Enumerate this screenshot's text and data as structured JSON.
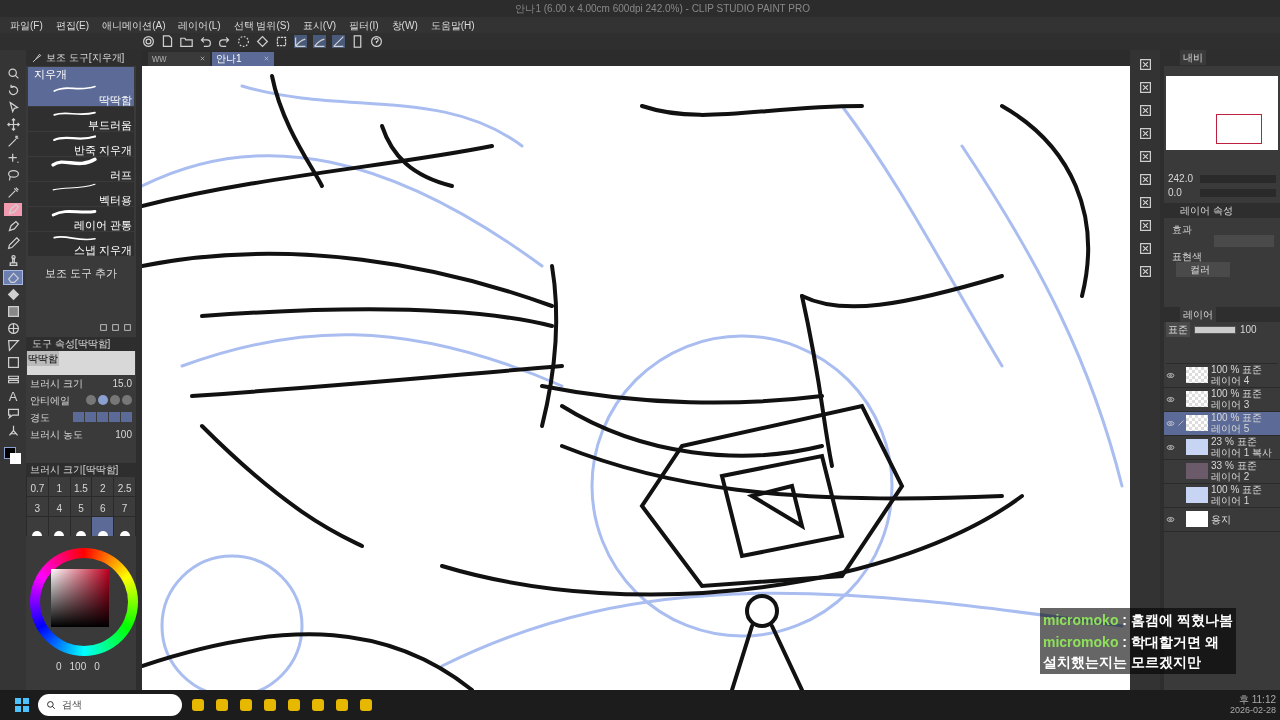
{
  "window": {
    "title": "안나1 (6.00 x 4.00cm 600dpi 242.0%) - CLIP STUDIO PAINT PRO"
  },
  "menu": [
    "파일(F)",
    "편집(E)",
    "애니메이션(A)",
    "레이어(L)",
    "선택 범위(S)",
    "표시(V)",
    "필터(I)",
    "창(W)",
    "도움말(H)"
  ],
  "document_tabs": [
    {
      "label": "ww",
      "selected": false
    },
    {
      "label": "안나1",
      "selected": true
    }
  ],
  "tools": [
    {
      "kind": "zoom",
      "selected": false,
      "marked": false
    },
    {
      "kind": "rotate",
      "selected": false,
      "marked": false
    },
    {
      "kind": "select",
      "selected": false,
      "marked": false
    },
    {
      "kind": "move",
      "selected": false,
      "marked": false
    },
    {
      "kind": "wand",
      "selected": false,
      "marked": false
    },
    {
      "kind": "sparkle",
      "selected": false,
      "marked": false
    },
    {
      "kind": "lasso",
      "selected": false,
      "marked": false
    },
    {
      "kind": "dropper",
      "selected": false,
      "marked": false
    },
    {
      "kind": "pen",
      "selected": false,
      "marked": true
    },
    {
      "kind": "pen",
      "selected": false,
      "marked": false
    },
    {
      "kind": "pencil",
      "selected": false,
      "marked": false
    },
    {
      "kind": "stamp",
      "selected": false,
      "marked": false
    },
    {
      "kind": "eraser",
      "selected": true,
      "marked": false
    },
    {
      "kind": "bucket",
      "selected": false,
      "marked": false
    },
    {
      "kind": "gradient",
      "selected": false,
      "marked": false
    },
    {
      "kind": "grid",
      "selected": false,
      "marked": false
    },
    {
      "kind": "triangle",
      "selected": false,
      "marked": false
    },
    {
      "kind": "square",
      "selected": false,
      "marked": false
    },
    {
      "kind": "stack",
      "selected": false,
      "marked": false
    },
    {
      "kind": "text",
      "glyph": "A",
      "selected": false,
      "marked": false
    },
    {
      "kind": "balloon",
      "selected": false,
      "marked": false
    },
    {
      "kind": "line",
      "selected": false,
      "marked": false
    }
  ],
  "subtool_panel": {
    "title": "보조 도구[지우개]",
    "group": "지우개",
    "items": [
      {
        "label": "딱딱함",
        "selected": true
      },
      {
        "label": "부드러움",
        "selected": false
      },
      {
        "label": "반죽 지우개",
        "selected": false
      },
      {
        "label": "러프",
        "selected": false
      },
      {
        "label": "벡터용",
        "selected": false
      },
      {
        "label": "레이어 관통",
        "selected": false
      },
      {
        "label": "스냅 지우개",
        "selected": false
      }
    ],
    "add_button": "보조 도구 추가"
  },
  "tool_property": {
    "title": "도구 속성[딱딱함]",
    "preview_label": "딱딱함",
    "brush_size_label": "브러시 크기",
    "brush_size": "15.0",
    "antialias_label": "안티에일",
    "antialias_options": [
      {
        "selected": false
      },
      {
        "selected": true
      },
      {
        "selected": false
      },
      {
        "selected": false
      }
    ],
    "hardness_label": "경도",
    "density_label": "브러시 농도",
    "density": "100"
  },
  "brush_size_panel": {
    "title": "브러시 크기[딱딱함]",
    "sizes": [
      {
        "label": "0.7",
        "selected": false
      },
      {
        "label": "1",
        "selected": false
      },
      {
        "label": "1.5",
        "selected": false
      },
      {
        "label": "2",
        "selected": false
      },
      {
        "label": "2.5",
        "selected": false
      },
      {
        "label": "3",
        "selected": false
      },
      {
        "label": "4",
        "selected": false
      },
      {
        "label": "5",
        "selected": false
      },
      {
        "label": "6",
        "selected": false
      },
      {
        "label": "7",
        "selected": false
      },
      {
        "selected": false
      },
      {
        "selected": false
      },
      {
        "selected": false
      },
      {
        "selected": true
      },
      {
        "selected": false
      }
    ]
  },
  "color_panel": {
    "readouts": [
      "0",
      "100",
      "0"
    ]
  },
  "navigator": {
    "title": "내비",
    "zoom": "242.0",
    "rotation": "0.0"
  },
  "layer_property": {
    "title": "레이어 속성",
    "effect_label": "효과",
    "expression_label": "표현색",
    "expression_value": "컬러"
  },
  "layers_panel": {
    "title": "레이어",
    "blend_mode": "표준",
    "opacity": "100",
    "opacity_slider": {
      "level": 1
    },
    "layers": [
      {
        "kind": "raster",
        "opacity": "100 %",
        "blend": "표준",
        "name": "레이어 4",
        "visible": true,
        "selected": false,
        "editing": false
      },
      {
        "kind": "raster",
        "opacity": "100 %",
        "blend": "표준",
        "name": "레이어 3",
        "visible": true,
        "selected": false,
        "editing": false
      },
      {
        "kind": "raster",
        "opacity": "100 %",
        "blend": "표준",
        "name": "레이어 5",
        "visible": true,
        "selected": true,
        "editing": true
      },
      {
        "kind": "sketch",
        "opacity": "23 %",
        "blend": "표준",
        "name": "레이어 1 복사",
        "visible": true,
        "selected": false,
        "editing": false
      },
      {
        "kind": "photo",
        "opacity": "33 %",
        "blend": "표준",
        "name": "레이어 2",
        "visible": false,
        "selected": false,
        "editing": false
      },
      {
        "kind": "sketch",
        "opacity": "100 %",
        "blend": "표준",
        "name": "레이어 1",
        "visible": false,
        "selected": false,
        "editing": false
      },
      {
        "kind": "paper",
        "name": "용지",
        "visible": true,
        "selected": false,
        "editing": false
      }
    ]
  },
  "chat": [
    {
      "user": "micromoko",
      "separator": ":",
      "text": "홈캠에 찍혔나봄"
    },
    {
      "user": "micromoko",
      "separator": ":",
      "text": "학대할거면 왜 설치했는지는 모르겠지만"
    }
  ],
  "taskbar": {
    "search_placeholder": "검색",
    "time": "후 11:12",
    "date": "2026-02-28"
  }
}
